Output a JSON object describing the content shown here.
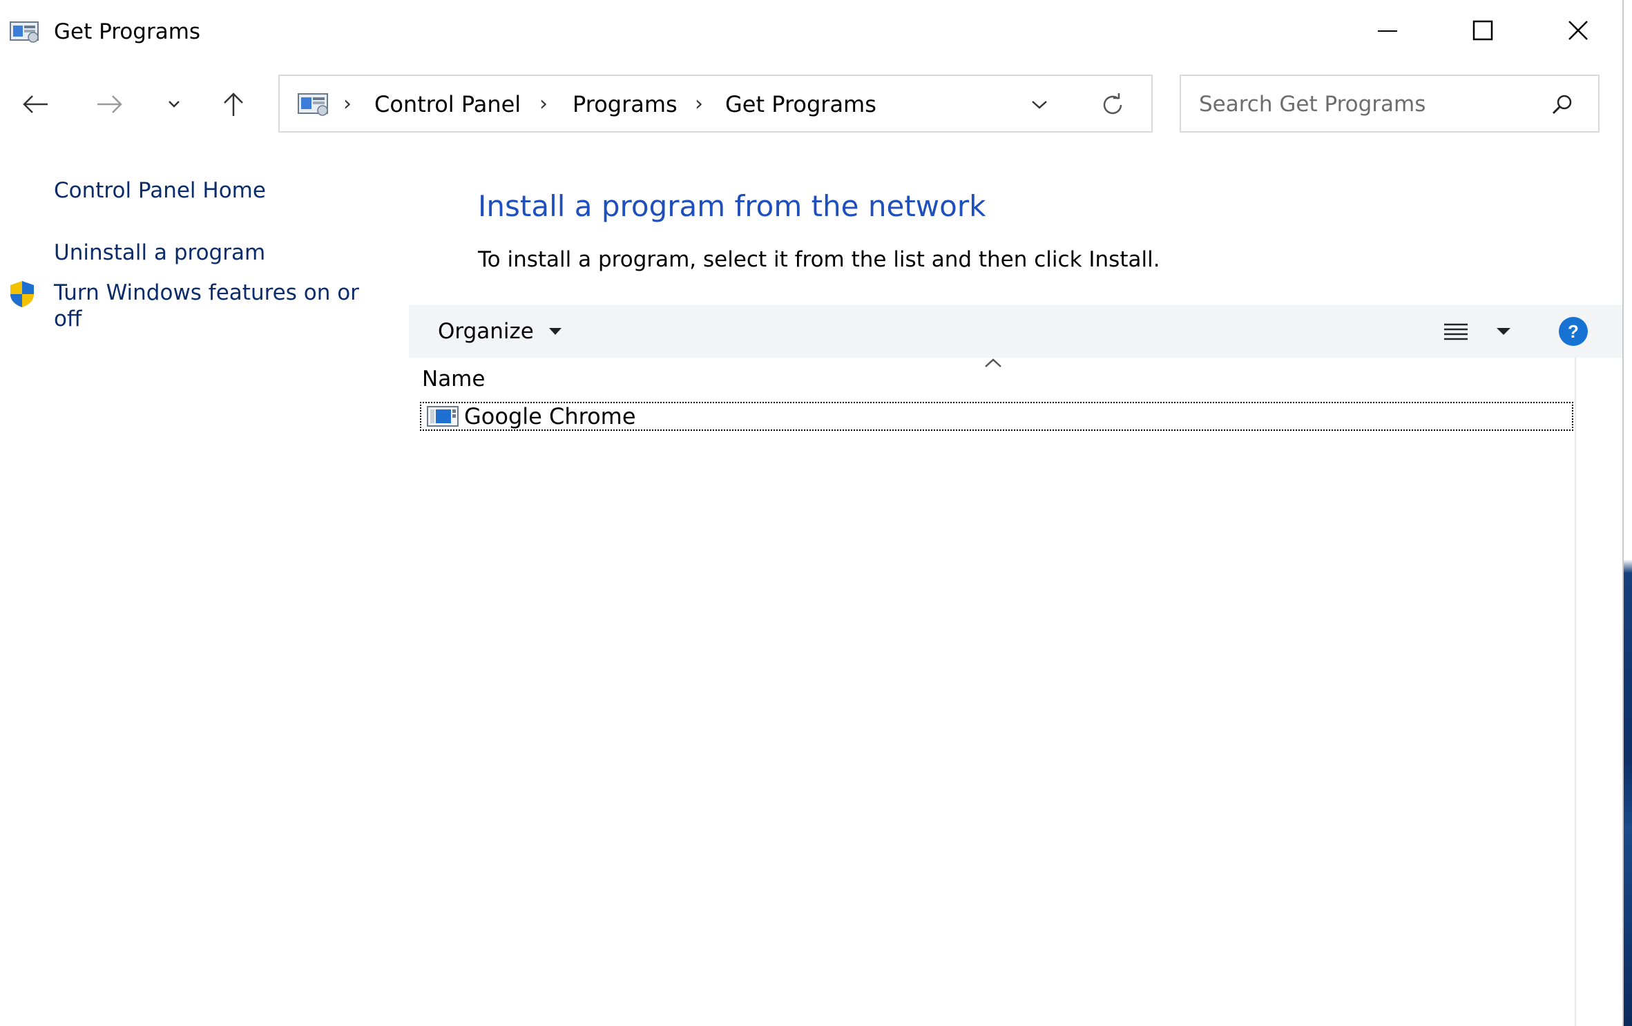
{
  "window": {
    "title": "Get Programs",
    "minimize_icon": "minimize-icon",
    "maximize_icon": "maximize-icon",
    "close_icon": "close-icon"
  },
  "navigation": {
    "back_icon": "arrow-left-icon",
    "forward_icon": "arrow-right-icon",
    "recent_icon": "chevron-down-icon",
    "up_icon": "arrow-up-icon"
  },
  "address_bar": {
    "breadcrumbs": [
      "Control Panel",
      "Programs",
      "Get Programs"
    ],
    "location_icon": "control-panel-icon",
    "dropdown_icon": "chevron-down-icon",
    "refresh_icon": "refresh-icon"
  },
  "search": {
    "placeholder": "Search Get Programs",
    "icon": "search-icon"
  },
  "left_pane": {
    "links": [
      "Control Panel Home",
      "Uninstall a program",
      "Turn Windows features on or",
      "off"
    ],
    "shield_icon": "shield-icon"
  },
  "main": {
    "title": "Install a program from the network",
    "description": "To install a program, select it from the list and then click Install."
  },
  "command_bar": {
    "organize_label": "Organize",
    "view_icon": "details-view-icon",
    "view_dropdown_icon": "caret-down-icon",
    "help_icon": "help-icon"
  },
  "list": {
    "column_header": "Name",
    "items": [
      {
        "name": "Google Chrome",
        "icon": "installer-package-icon"
      }
    ]
  },
  "colors": {
    "link": "#0b2c6b",
    "title_blue": "#1e4fbd",
    "command_bar_bg": "#f3f4f6",
    "help_blue": "#1673d4"
  }
}
